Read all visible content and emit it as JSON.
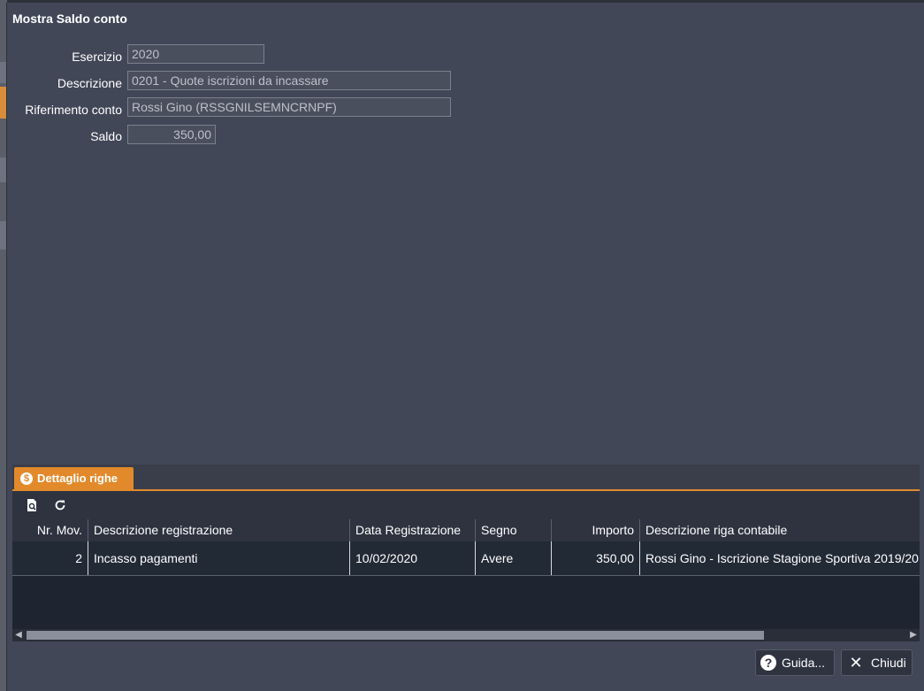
{
  "dialog": {
    "title": "Mostra Saldo conto"
  },
  "form": {
    "esercizio": {
      "label": "Esercizio",
      "value": "2020"
    },
    "descrizione": {
      "label": "Descrizione",
      "value": "0201 - Quote iscrizioni da incassare"
    },
    "riferimento": {
      "label": "Riferimento conto",
      "value": "Rossi Gino (RSSGNILSEMNCRNPF)"
    },
    "saldo": {
      "label": "Saldo",
      "value": "350,00"
    }
  },
  "panel": {
    "tab_label": "Dettaglio righe",
    "tab_icon": "dollar-icon",
    "toolbar": {
      "icons": [
        "preview-icon",
        "refresh-icon"
      ]
    },
    "table": {
      "columns": [
        "Nr. Mov.",
        "Descrizione registrazione",
        "Data Registrazione",
        "Segno",
        "Importo",
        "Descrizione riga contabile"
      ],
      "rows": [
        [
          "2",
          "Incasso pagamenti",
          "10/02/2020",
          "Avere",
          "350,00",
          "Rossi Gino - Iscrizione Stagione Sportiva 2019/20"
        ]
      ]
    }
  },
  "buttons": {
    "help": {
      "label": "Guida...",
      "icon": "question-circle-icon"
    },
    "close": {
      "label": "Chiudi",
      "icon": "close-icon"
    }
  },
  "colors": {
    "accent": "#e28a2b",
    "background": "#424757"
  }
}
